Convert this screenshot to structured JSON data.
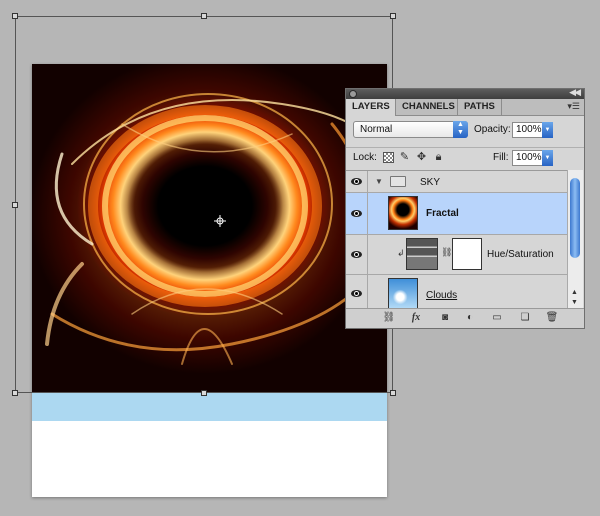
{
  "panel": {
    "tabs": [
      "LAYERS",
      "CHANNELS",
      "PATHS"
    ],
    "blend_mode": "Normal",
    "opacity_label": "Opacity:",
    "opacity_value": "100%",
    "lock_label": "Lock:",
    "fill_label": "Fill:",
    "fill_value": "100%",
    "layers": [
      {
        "name": "SKY",
        "type": "group",
        "visible": true
      },
      {
        "name": "Fractal",
        "type": "image",
        "visible": true,
        "selected": true
      },
      {
        "name": "Hue/Saturation",
        "type": "adjustment",
        "visible": true
      },
      {
        "name": "Clouds",
        "type": "image",
        "visible": true
      }
    ]
  },
  "colors": {
    "selection": "#b8d4fb",
    "sky_band": "#acd8f1",
    "workspace": "#b6b6b6"
  },
  "icons": {
    "footer": [
      "link-layers-icon",
      "fx-icon",
      "layer-mask-icon",
      "adjustment-layer-icon",
      "new-group-icon",
      "new-layer-icon",
      "trash-icon"
    ]
  }
}
